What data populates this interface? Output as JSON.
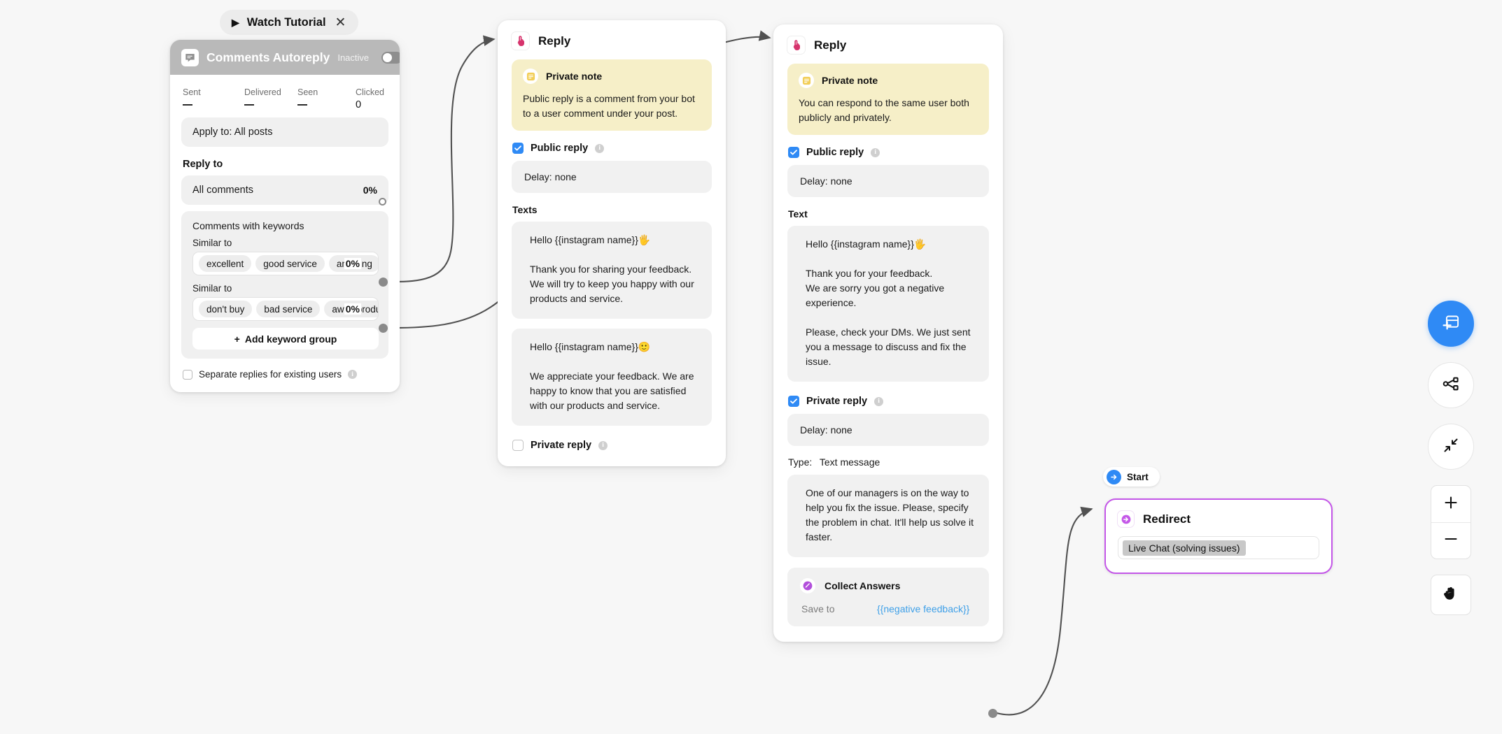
{
  "tutorial": {
    "label": "Watch Tutorial",
    "play_icon": "play-icon",
    "close_icon": "close-icon"
  },
  "trigger": {
    "icon": "comment-bubble-icon",
    "title": "Comments Autoreply",
    "state_label": "Inactive",
    "stats": [
      {
        "label": "Sent",
        "value": "—"
      },
      {
        "label": "Delivered",
        "value": "—"
      },
      {
        "label": "Seen",
        "value": "—"
      },
      {
        "label": "Clicked",
        "value": "0"
      }
    ],
    "apply_to": "Apply to: All posts",
    "reply_to_title": "Reply to",
    "all_comments": {
      "label": "All comments",
      "percent": "0%"
    },
    "keywords_title": "Comments with keywords",
    "groups": [
      {
        "sub_label": "Similar to",
        "chips": [
          "excellent",
          "good service",
          "amazing"
        ],
        "percent": "0%"
      },
      {
        "sub_label": "Similar to",
        "chips": [
          "don't buy",
          "bad service",
          "awful product"
        ],
        "percent": "0%"
      }
    ],
    "add_group_label": "Add keyword group",
    "add_group_plus": "+",
    "separate_replies": "Separate replies for existing users"
  },
  "reply_one": {
    "icon": "hand-tap-icon",
    "title": "Reply",
    "note": {
      "icon": "note-lines-icon",
      "title": "Private note",
      "text": "Public reply is a comment from your bot to a user comment under your post."
    },
    "public_reply": {
      "label": "Public reply",
      "checked": true,
      "info_icon": "info-icon"
    },
    "delay": "Delay: none",
    "texts_label": "Texts",
    "texts": [
      "Hello {{instagram name}}🖐️\n\nThank you for sharing your feedback. We will try to keep you happy with our products and service.",
      "Hello {{instagram name}}🙂\n\nWe appreciate your feedback. We are happy to know that you are satisfied with our products and service."
    ],
    "private_reply": {
      "label": "Private reply",
      "checked": false,
      "info_icon": "info-icon"
    }
  },
  "reply_two": {
    "icon": "hand-tap-icon",
    "title": "Reply",
    "note": {
      "icon": "note-lines-icon",
      "title": "Private note",
      "text": "You can respond to the same user both publicly and privately."
    },
    "public_reply": {
      "label": "Public reply",
      "checked": true,
      "info_icon": "info-icon"
    },
    "public_delay": "Delay: none",
    "text_label": "Text",
    "text": "Hello {{instagram name}}🖐️\n\nThank you for your feedback.\nWe are sorry you got a negative experience.\n\nPlease, check your DMs. We just sent you a message to discuss and fix the issue.",
    "private_reply": {
      "label": "Private reply",
      "checked": true,
      "info_icon": "info-icon"
    },
    "private_delay": "Delay: none",
    "type_key": "Type:",
    "type_value": "Text message",
    "private_text": "One of our managers is on the way to help you fix the issue. Please, specify the problem in chat. It'll help us solve it faster.",
    "collect": {
      "icon": "collect-answers-icon",
      "title": "Collect Answers",
      "save_key": "Save to",
      "save_value": "{{negative feedback}}"
    }
  },
  "start_badge": {
    "icon": "arrow-right-circle-icon",
    "label": "Start"
  },
  "redirect": {
    "icon": "redirect-arrow-icon",
    "title": "Redirect",
    "value": "Live Chat (solving issues)"
  },
  "toolbar": [
    {
      "name": "add-block-button",
      "icon": "add-block-icon"
    },
    {
      "name": "auto-layout-button",
      "icon": "sitemap-icon"
    },
    {
      "name": "fit-view-button",
      "icon": "collapse-arrows-icon"
    },
    {
      "name": "zoom-in-button",
      "icon": "plus-icon"
    },
    {
      "name": "zoom-out-button",
      "icon": "minus-icon"
    },
    {
      "name": "pan-button",
      "icon": "hand-icon"
    }
  ],
  "colors": {
    "accent_blue": "#2f8af5",
    "note_yellow": "#f6efc8",
    "redirect_purple": "#c457e8",
    "link_blue": "#3fa0e8",
    "canvas": "#f7f7f7"
  }
}
